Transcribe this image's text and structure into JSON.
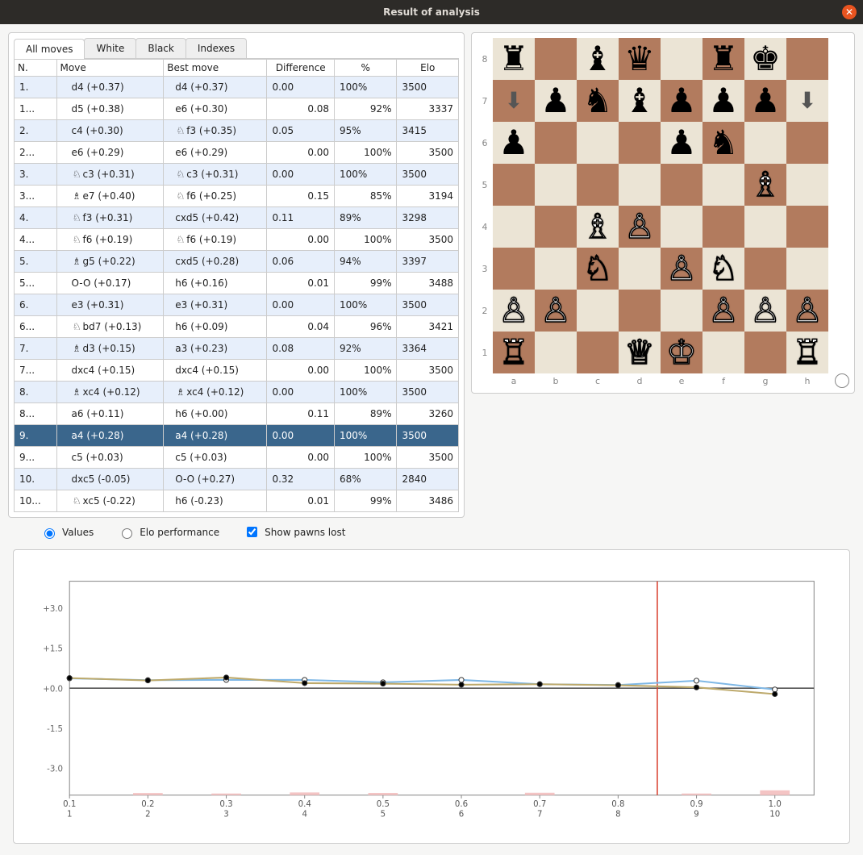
{
  "window": {
    "title": "Result of analysis"
  },
  "tabs": [
    "All moves",
    "White",
    "Black",
    "Indexes"
  ],
  "active_tab": 0,
  "columns": [
    "N.",
    "Move",
    "Best move",
    "Difference",
    "%",
    "Elo"
  ],
  "pieces": {
    "N": "♘",
    "B": "♗",
    "R": "♖",
    "Q": "♕",
    "K": "♔"
  },
  "rows": [
    {
      "n": "1.",
      "w": true,
      "mp": "",
      "m": "d4 (+0.37)",
      "bp": "",
      "b": "d4 (+0.37)",
      "d": "0.00",
      "pct": "100%",
      "elo": "3500"
    },
    {
      "n": "1...",
      "w": false,
      "mp": "",
      "m": "d5 (+0.38)",
      "bp": "",
      "b": "e6 (+0.30)",
      "d": "0.08",
      "pct": "92%",
      "elo": "3337"
    },
    {
      "n": "2.",
      "w": true,
      "mp": "",
      "m": "c4 (+0.30)",
      "bp": "N",
      "b": "f3 (+0.35)",
      "d": "0.05",
      "pct": "95%",
      "elo": "3415"
    },
    {
      "n": "2...",
      "w": false,
      "mp": "",
      "m": "e6 (+0.29)",
      "bp": "",
      "b": "e6 (+0.29)",
      "d": "0.00",
      "pct": "100%",
      "elo": "3500"
    },
    {
      "n": "3.",
      "w": true,
      "mp": "N",
      "m": "c3 (+0.31)",
      "bp": "N",
      "b": "c3 (+0.31)",
      "d": "0.00",
      "pct": "100%",
      "elo": "3500"
    },
    {
      "n": "3...",
      "w": false,
      "mp": "B",
      "m": "e7 (+0.40)",
      "bp": "N",
      "b": "f6 (+0.25)",
      "d": "0.15",
      "pct": "85%",
      "elo": "3194"
    },
    {
      "n": "4.",
      "w": true,
      "mp": "N",
      "m": "f3 (+0.31)",
      "bp": "",
      "b": "cxd5 (+0.42)",
      "d": "0.11",
      "pct": "89%",
      "elo": "3298"
    },
    {
      "n": "4...",
      "w": false,
      "mp": "N",
      "m": "f6 (+0.19)",
      "bp": "N",
      "b": "f6 (+0.19)",
      "d": "0.00",
      "pct": "100%",
      "elo": "3500"
    },
    {
      "n": "5.",
      "w": true,
      "mp": "B",
      "m": "g5 (+0.22)",
      "bp": "",
      "b": "cxd5 (+0.28)",
      "d": "0.06",
      "pct": "94%",
      "elo": "3397"
    },
    {
      "n": "5...",
      "w": false,
      "mp": "",
      "m": "O-O (+0.17)",
      "bp": "",
      "b": "h6 (+0.16)",
      "d": "0.01",
      "pct": "99%",
      "elo": "3488"
    },
    {
      "n": "6.",
      "w": true,
      "mp": "",
      "m": "e3 (+0.31)",
      "bp": "",
      "b": "e3 (+0.31)",
      "d": "0.00",
      "pct": "100%",
      "elo": "3500"
    },
    {
      "n": "6...",
      "w": false,
      "mp": "N",
      "m": "bd7 (+0.13)",
      "bp": "",
      "b": "h6 (+0.09)",
      "d": "0.04",
      "pct": "96%",
      "elo": "3421"
    },
    {
      "n": "7.",
      "w": true,
      "mp": "B",
      "m": "d3 (+0.15)",
      "bp": "",
      "b": "a3 (+0.23)",
      "d": "0.08",
      "pct": "92%",
      "elo": "3364"
    },
    {
      "n": "7...",
      "w": false,
      "mp": "",
      "m": "dxc4 (+0.15)",
      "bp": "",
      "b": "dxc4 (+0.15)",
      "d": "0.00",
      "pct": "100%",
      "elo": "3500"
    },
    {
      "n": "8.",
      "w": true,
      "mp": "B",
      "m": "xc4 (+0.12)",
      "bp": "B",
      "b": "xc4 (+0.12)",
      "d": "0.00",
      "pct": "100%",
      "elo": "3500"
    },
    {
      "n": "8...",
      "w": false,
      "mp": "",
      "m": "a6 (+0.11)",
      "bp": "",
      "b": "h6 (+0.00)",
      "d": "0.11",
      "pct": "89%",
      "elo": "3260"
    },
    {
      "n": "9.",
      "w": true,
      "mp": "",
      "m": "a4 (+0.28)",
      "bp": "",
      "b": "a4 (+0.28)",
      "d": "0.00",
      "pct": "100%",
      "elo": "3500",
      "sel": true
    },
    {
      "n": "9...",
      "w": false,
      "mp": "",
      "m": "c5 (+0.03)",
      "bp": "",
      "b": "c5 (+0.03)",
      "d": "0.00",
      "pct": "100%",
      "elo": "3500"
    },
    {
      "n": "10.",
      "w": true,
      "mp": "",
      "m": "dxc5 (-0.05)",
      "bp": "",
      "b": "O-O (+0.27)",
      "d": "0.32",
      "pct": "68%",
      "elo": "2840"
    },
    {
      "n": "10...",
      "w": false,
      "mp": "N",
      "m": "xc5 (-0.22)",
      "bp": "",
      "b": "h6 (-0.23)",
      "d": "0.01",
      "pct": "99%",
      "elo": "3486"
    }
  ],
  "options": {
    "values": "Values",
    "elo": "Elo performance",
    "showpawns": "Show pawns lost",
    "values_on": true,
    "elo_on": false,
    "showpawns_on": true
  },
  "board": {
    "files": [
      "a",
      "b",
      "c",
      "d",
      "e",
      "f",
      "g",
      "h"
    ],
    "ranks": [
      "8",
      "7",
      "6",
      "5",
      "4",
      "3",
      "2",
      "1"
    ],
    "squares": [
      [
        "br",
        "",
        "bb",
        "bq",
        "",
        "br",
        "bk",
        ""
      ],
      [
        "",
        "bp",
        "bn",
        "bb",
        "bp",
        "bp",
        "bp",
        " "
      ],
      [
        "bp",
        "",
        "",
        "",
        "bp",
        "bn",
        "",
        ""
      ],
      [
        "",
        "",
        "",
        "",
        "",
        "",
        "wb",
        ""
      ],
      [
        "",
        "",
        "wb",
        "wp",
        "",
        "",
        "",
        ""
      ],
      [
        "",
        "",
        "wn",
        "",
        "wp",
        "wn",
        "",
        ""
      ],
      [
        "wp",
        "wp",
        "",
        "",
        "",
        "wp",
        "wp",
        "wp"
      ],
      [
        "wr",
        "",
        "",
        "wq",
        "wk",
        "",
        "",
        "wr"
      ]
    ],
    "arrows": [
      {
        "sq": "a7",
        "dir": "down"
      },
      {
        "sq": "h7",
        "dir": "down"
      }
    ]
  },
  "chart_data": {
    "type": "line",
    "xlabel": "",
    "ylabel": "",
    "x": [
      1,
      2,
      3,
      4,
      5,
      6,
      7,
      8,
      9,
      10
    ],
    "xticks": [
      "0.1",
      "0.2",
      "0.3",
      "0.4",
      "0.5",
      "0.6",
      "0.7",
      "0.8",
      "0.9",
      "1.0"
    ],
    "xsub": [
      "1",
      "2",
      "3",
      "4",
      "5",
      "6",
      "7",
      "8",
      "9",
      "10"
    ],
    "ylim": [
      -4,
      4
    ],
    "yticks": [
      -3.0,
      -1.5,
      0.0,
      1.5,
      3.0
    ],
    "series": [
      {
        "name": "white",
        "color": "#7fb8e6",
        "values": [
          0.37,
          0.3,
          0.31,
          0.31,
          0.22,
          0.31,
          0.15,
          0.12,
          0.28,
          -0.05
        ]
      },
      {
        "name": "black",
        "color": "#bda96b",
        "values": [
          0.38,
          0.29,
          0.4,
          0.19,
          0.17,
          0.13,
          0.15,
          0.11,
          0.03,
          -0.22
        ]
      }
    ],
    "cursor_x": 8.5,
    "bars": [
      {
        "x": 2,
        "h": 0.05
      },
      {
        "x": 3,
        "h": 0.0
      },
      {
        "x": 4,
        "h": 0.11
      },
      {
        "x": 5,
        "h": 0.06
      },
      {
        "x": 7,
        "h": 0.08
      },
      {
        "x": 9,
        "h": 0.0
      },
      {
        "x": 10,
        "h": 0.32
      }
    ]
  }
}
